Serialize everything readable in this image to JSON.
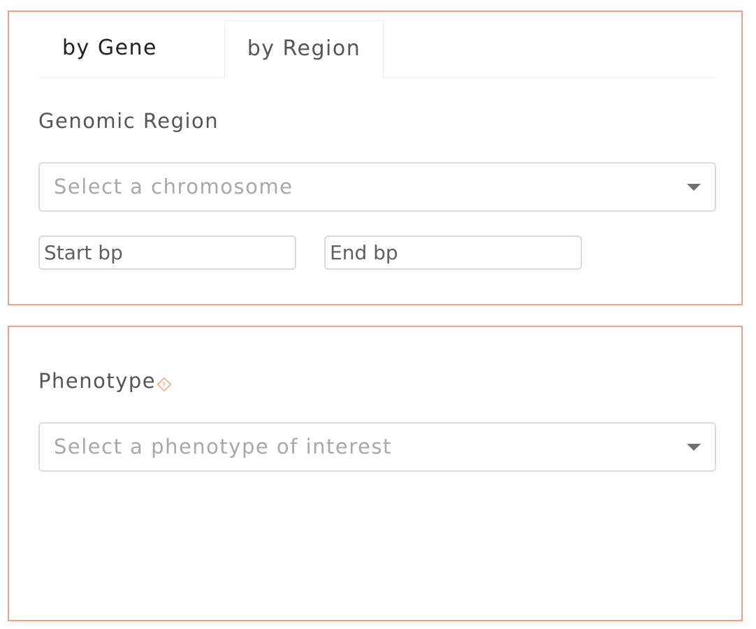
{
  "tabs": [
    {
      "label": "by Gene",
      "active": false
    },
    {
      "label": "by Region",
      "active": true
    }
  ],
  "region": {
    "label": "Genomic Region",
    "chromosome_placeholder": "Select a chromosome",
    "start_placeholder": "Start bp",
    "end_placeholder": "End bp"
  },
  "phenotype": {
    "label": "Phenotype",
    "help_icon": "question-diamond-icon",
    "placeholder": "Select a phenotype of interest"
  },
  "colors": {
    "panel_border": "#eda383",
    "help_icon": "#f0a06e"
  }
}
